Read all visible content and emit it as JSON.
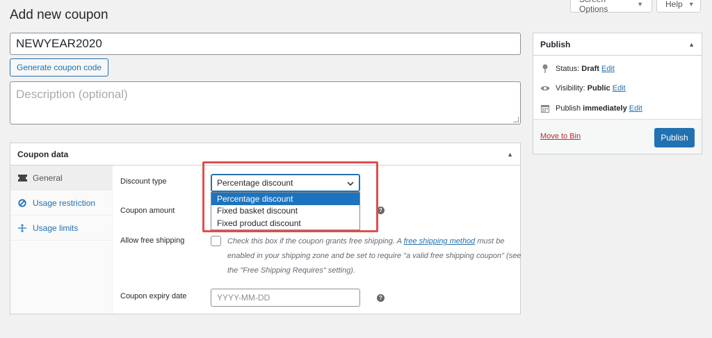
{
  "screen_meta": {
    "screen_options_label": "Screen Options",
    "help_label": "Help"
  },
  "page": {
    "title": "Add new coupon",
    "coupon_code": "NEWYEAR2020",
    "generate_label": "Generate coupon code",
    "description_placeholder": "Description (optional)"
  },
  "coupon_data": {
    "title": "Coupon data",
    "tabs": [
      {
        "label": "General",
        "icon": "ticket-icon",
        "active": true
      },
      {
        "label": "Usage restriction",
        "icon": "restricted-icon",
        "active": false
      },
      {
        "label": "Usage limits",
        "icon": "limits-icon",
        "active": false
      }
    ],
    "fields": {
      "discount_type_label": "Discount type",
      "discount_type_value": "Percentage discount",
      "discount_options": [
        "Percentage discount",
        "Fixed basket discount",
        "Fixed product discount"
      ],
      "coupon_amount_label": "Coupon amount",
      "free_shipping_label": "Allow free shipping",
      "free_shipping_desc_1": "Check this box if the coupon grants free shipping. A ",
      "free_shipping_link": "free shipping method",
      "free_shipping_desc_2": " must be enabled in your shipping zone and be set to require \"a valid free shipping coupon\" (see the \"Free Shipping Requires\" setting).",
      "expiry_label": "Coupon expiry date",
      "expiry_placeholder": "YYYY-MM-DD"
    }
  },
  "publish": {
    "title": "Publish",
    "status_label": "Status: ",
    "status_value": "Draft",
    "visibility_label": "Visibility: ",
    "visibility_value": "Public",
    "publish_label": "Publish ",
    "publish_value": "immediately",
    "edit_label": "Edit",
    "move_to_bin": "Move to Bin",
    "publish_button": "Publish"
  },
  "colors": {
    "accent": "#2271b1",
    "highlight": "#e14d4d",
    "selected_option": "#1e73be",
    "danger": "#b32d2e"
  }
}
